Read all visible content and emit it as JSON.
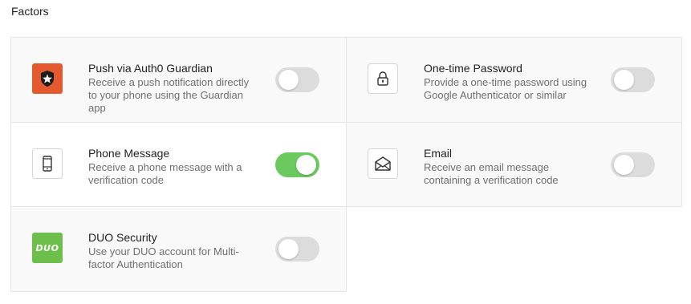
{
  "section": {
    "title": "Factors"
  },
  "factors": [
    {
      "title": "Push via Auth0 Guardian",
      "description": "Receive a push notification directly to your phone using the Guardian app",
      "icon": "auth0-guardian-icon",
      "enabled": false
    },
    {
      "title": "One-time Password",
      "description": "Provide a one-time password using Google Authenticator or similar",
      "icon": "lock-icon",
      "enabled": false
    },
    {
      "title": "Phone Message",
      "description": "Receive a phone message with a verification code",
      "icon": "phone-icon",
      "enabled": true
    },
    {
      "title": "Email",
      "description": "Receive an email message containing a verification code",
      "icon": "envelope-icon",
      "enabled": false
    },
    {
      "title": "DUO Security",
      "description": "Use your DUO account for Multi-factor Authentication",
      "icon": "duo-icon",
      "icon_text": "DUO",
      "enabled": false
    }
  ],
  "colors": {
    "toggle_on": "#6bc95f",
    "toggle_off": "#dcdcdc",
    "guardian_brand": "#e45a2e",
    "duo_brand": "#6cbf4b"
  }
}
